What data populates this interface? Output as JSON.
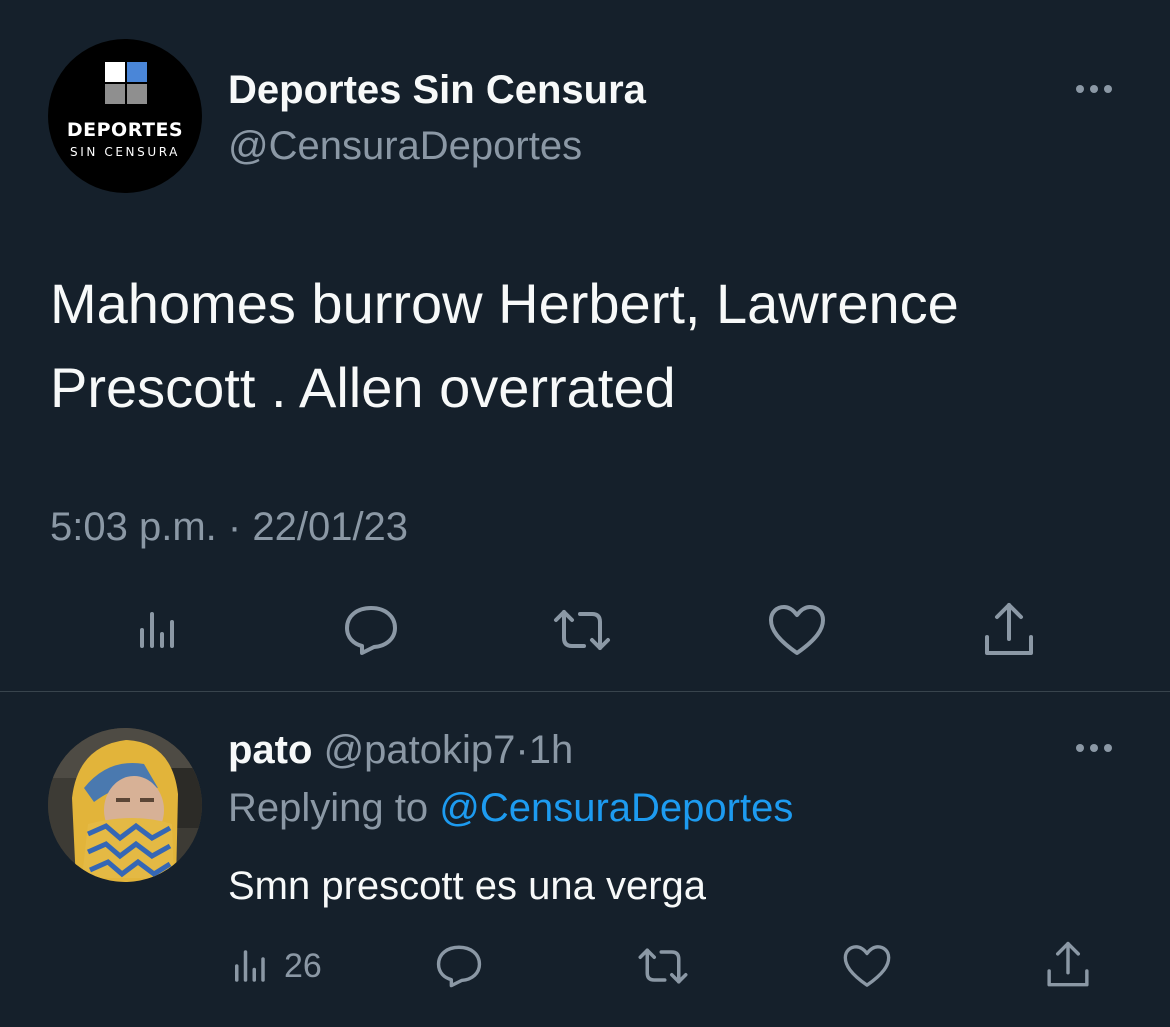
{
  "colors": {
    "background": "#15202b",
    "primary_text": "#f7f9f9",
    "secondary_text": "#8b98a5",
    "link": "#1d9bf0",
    "divider": "#38444d",
    "icon": "#8b98a5"
  },
  "main_tweet": {
    "author": {
      "display_name": "Deportes Sin Censura",
      "handle": "@CensuraDeportes",
      "avatar_logo": {
        "line1": "DEPORTES",
        "line2": "SIN CENSURA"
      }
    },
    "text": "Mahomes burrow Herbert, Lawrence Prescott . Allen overrated",
    "time": "5:03 p.m.",
    "separator": "·",
    "date": "22/01/23",
    "actions": [
      {
        "name": "views",
        "icon": "analytics-icon"
      },
      {
        "name": "reply",
        "icon": "reply-icon"
      },
      {
        "name": "retweet",
        "icon": "retweet-icon"
      },
      {
        "name": "like",
        "icon": "heart-icon"
      },
      {
        "name": "share",
        "icon": "share-icon"
      }
    ]
  },
  "reply_tweet": {
    "author": {
      "display_name": "pato",
      "handle": "@patokip7",
      "separator": "·",
      "time": "1h"
    },
    "replying_prefix": "Replying to",
    "replying_to": "@CensuraDeportes",
    "text": "Smn prescott es una verga",
    "views_count": "26",
    "actions": [
      {
        "name": "views",
        "icon": "analytics-icon"
      },
      {
        "name": "reply",
        "icon": "reply-icon"
      },
      {
        "name": "retweet",
        "icon": "retweet-icon"
      },
      {
        "name": "like",
        "icon": "heart-icon"
      },
      {
        "name": "share",
        "icon": "share-icon"
      }
    ]
  }
}
